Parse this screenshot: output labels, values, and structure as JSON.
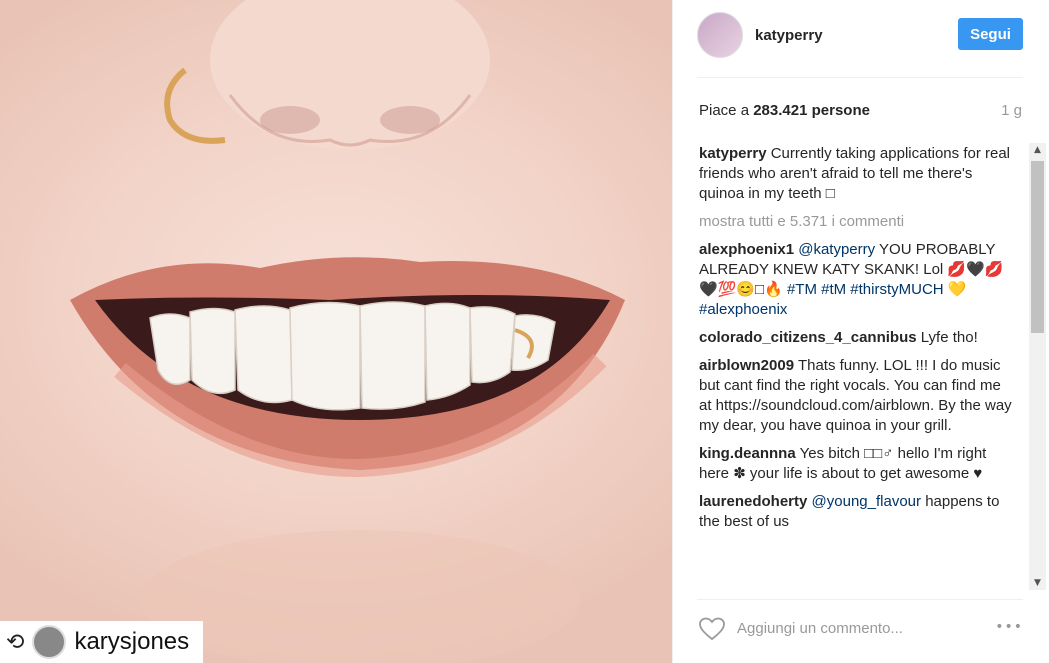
{
  "post": {
    "username": "katyperry",
    "follow_label": "Segui",
    "likes_prefix": "Piace a",
    "likes_count": "283.421",
    "likes_suffix": "persone",
    "time_ago": "1 g",
    "caption": "Currently taking applications for real friends who aren't afraid to tell me there's quinoa in my teeth □",
    "show_all": "mostra tutti e 5.371 i commenti",
    "add_comment_placeholder": "Aggiungi un commento...",
    "more_icon": "•••"
  },
  "comments": [
    {
      "user": "alexphoenix1",
      "mention": "@katyperry",
      "text": "YOU PROBABLY ALREADY KNEW KATY SKANK! Lol 💋🖤💋🖤💯😊□🔥",
      "tags": "#TM #tM #thirstyMUCH 💛#alexphoenix"
    },
    {
      "user": "colorado_citizens_4_cannibus",
      "text": "Lyfe tho!"
    },
    {
      "user": "airblown2009",
      "text": "Thats funny. LOL !!! I do music but cant find the right vocals. You can find me at https://soundcloud.com/airblown. By the way my dear, you have quinoa in your grill."
    },
    {
      "user": "king.deannna",
      "text": "Yes bitch □□♂ hello I'm right here ✽ your life is about to get awesome ♥"
    },
    {
      "user": "laurenedoherty",
      "mention": "@young_flavour",
      "text": "happens to the best of us"
    }
  ],
  "repost": {
    "icon": "⟲",
    "username": "karysjones"
  },
  "colors": {
    "follow_button": "#3897f0",
    "hashtag": "#003569",
    "muted": "#999999"
  }
}
